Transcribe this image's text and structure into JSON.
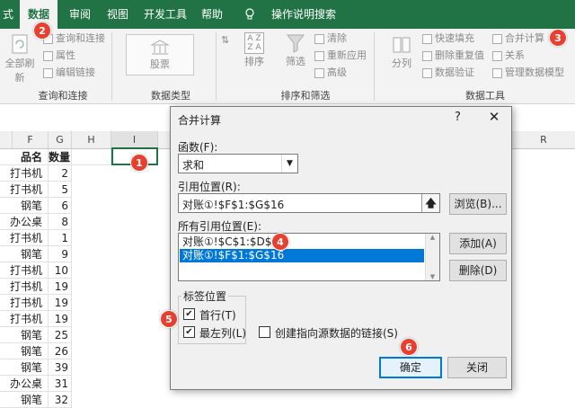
{
  "tabs": [
    "式",
    "数据",
    "审阅",
    "视图",
    "开发工具",
    "帮助",
    "操作说明搜索"
  ],
  "ribbon": {
    "refresh_all": "全部刷新",
    "query_connect": "查询和连接",
    "properties": "属性",
    "edit_links": "编辑链接",
    "group_query": "查询和连接",
    "stocks": "股票",
    "group_datatype": "数据类型",
    "sort": "排序",
    "filter": "筛选",
    "clear": "清除",
    "reapply": "重新应用",
    "advanced": "高级",
    "group_sortfilter": "排序和筛选",
    "text_to_columns": "分列",
    "flash_fill": "快速填充",
    "remove_dup": "删除重复值",
    "data_validation": "数据验证",
    "consolidate": "合并计算",
    "relationships": "关系",
    "manage_model": "管理数据模型",
    "group_datatools": "数据工具",
    "sort_az_top": "A Z",
    "sort_az_bottom": "Z A"
  },
  "grid": {
    "columns": [
      "F",
      "G",
      "H",
      "I",
      "R"
    ],
    "header_row": [
      "品名",
      "数量2"
    ],
    "rows": [
      [
        "打书机",
        "2"
      ],
      [
        "打书机",
        "5"
      ],
      [
        "钢笔",
        "6"
      ],
      [
        "办公桌",
        "8"
      ],
      [
        "打书机",
        "1"
      ],
      [
        "钢笔",
        "9"
      ],
      [
        "打书机",
        "10"
      ],
      [
        "打书机",
        "19"
      ],
      [
        "打书机",
        "19"
      ],
      [
        "打书机",
        "19"
      ],
      [
        "钢笔",
        "25"
      ],
      [
        "钢笔",
        "26"
      ],
      [
        "钢笔",
        "39"
      ],
      [
        "办公桌",
        "31"
      ],
      [
        "钢笔",
        "32"
      ]
    ]
  },
  "dialog": {
    "title": "合并计算",
    "help": "?",
    "close": "✕",
    "function_label": "函数(F):",
    "function_value": "求和",
    "ref_label": "引用位置(R):",
    "ref_value": "对账①!$F$1:$G$16",
    "browse": "浏览(B)...",
    "all_refs_label": "所有引用位置(E):",
    "all_refs": [
      "对账①!$C$1:$D$16",
      "对账①!$F$1:$G$16"
    ],
    "add": "添加(A)",
    "delete": "删除(D)",
    "label_pos": "标签位置",
    "top_row": "首行(T)",
    "left_col": "最左列(L)",
    "create_links": "创建指向源数据的链接(S)",
    "ok": "确定",
    "close_btn": "关闭"
  },
  "badges": [
    "1",
    "2",
    "3",
    "4",
    "5",
    "6"
  ],
  "colors": {
    "brand": "#217346",
    "badge": "#e8402f",
    "selection": "#0078d7"
  }
}
